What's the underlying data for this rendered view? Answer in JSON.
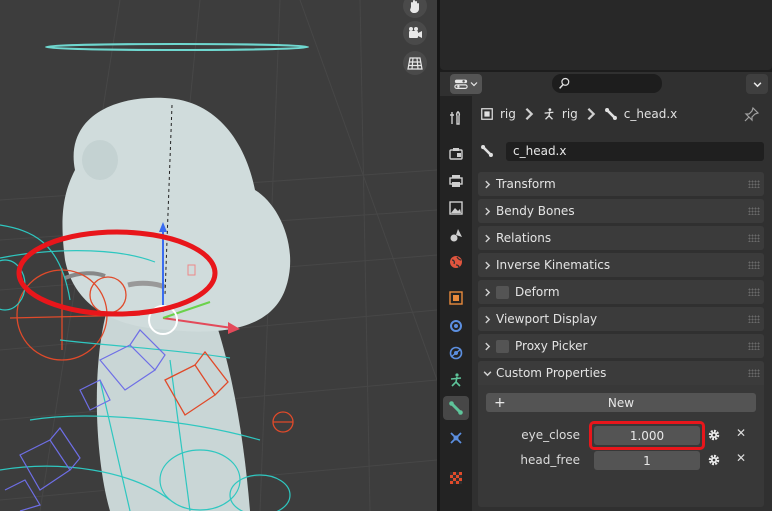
{
  "viewport": {
    "nav_icons": [
      "hand-icon",
      "camera-icon",
      "grid-icon"
    ]
  },
  "header": {
    "editor_type_icon": "properties-editor-icon",
    "search_placeholder": "",
    "search_icon": "search-icon"
  },
  "tabs": [
    {
      "name": "tool-tab",
      "icon": "tool-icon"
    },
    {
      "name": "render-tab",
      "icon": "camera-back-icon"
    },
    {
      "name": "output-tab",
      "icon": "printer-icon"
    },
    {
      "name": "view-layer-tab",
      "icon": "image-icon"
    },
    {
      "name": "scene-tab",
      "icon": "scene-icon"
    },
    {
      "name": "world-tab",
      "icon": "world-icon"
    },
    {
      "name": "object-tab",
      "icon": "object-icon"
    },
    {
      "name": "modifiers-tab",
      "icon": "modifier-icon"
    },
    {
      "name": "physics-tab",
      "icon": "physics-icon"
    },
    {
      "name": "armature-data-tab",
      "icon": "armature-icon"
    },
    {
      "name": "bone-tab",
      "icon": "bone-icon",
      "active": true
    },
    {
      "name": "bone-constraints-tab",
      "icon": "bone-constraint-icon"
    },
    {
      "name": "texture-tab",
      "icon": "checker-icon"
    }
  ],
  "breadcrumb": {
    "item1": "rig",
    "item2": "rig",
    "item3": "c_head.x"
  },
  "bone_name": "c_head.x",
  "panels": {
    "transform": "Transform",
    "bendy_bones": "Bendy Bones",
    "relations": "Relations",
    "inverse_kinematics": "Inverse Kinematics",
    "deform": "Deform",
    "viewport_display": "Viewport Display",
    "proxy_picker": "Proxy Picker",
    "custom_properties": "Custom Properties"
  },
  "custom_properties": {
    "new_label": "New",
    "new_icon": "+",
    "items": [
      {
        "name": "eye_close",
        "value": "1.000"
      },
      {
        "name": "head_free",
        "value": "1"
      }
    ],
    "close_glyph": "✕"
  },
  "colors": {
    "highlight": "#e8161b",
    "active_tab": "#474747",
    "bone_green": "#5ec49a"
  }
}
